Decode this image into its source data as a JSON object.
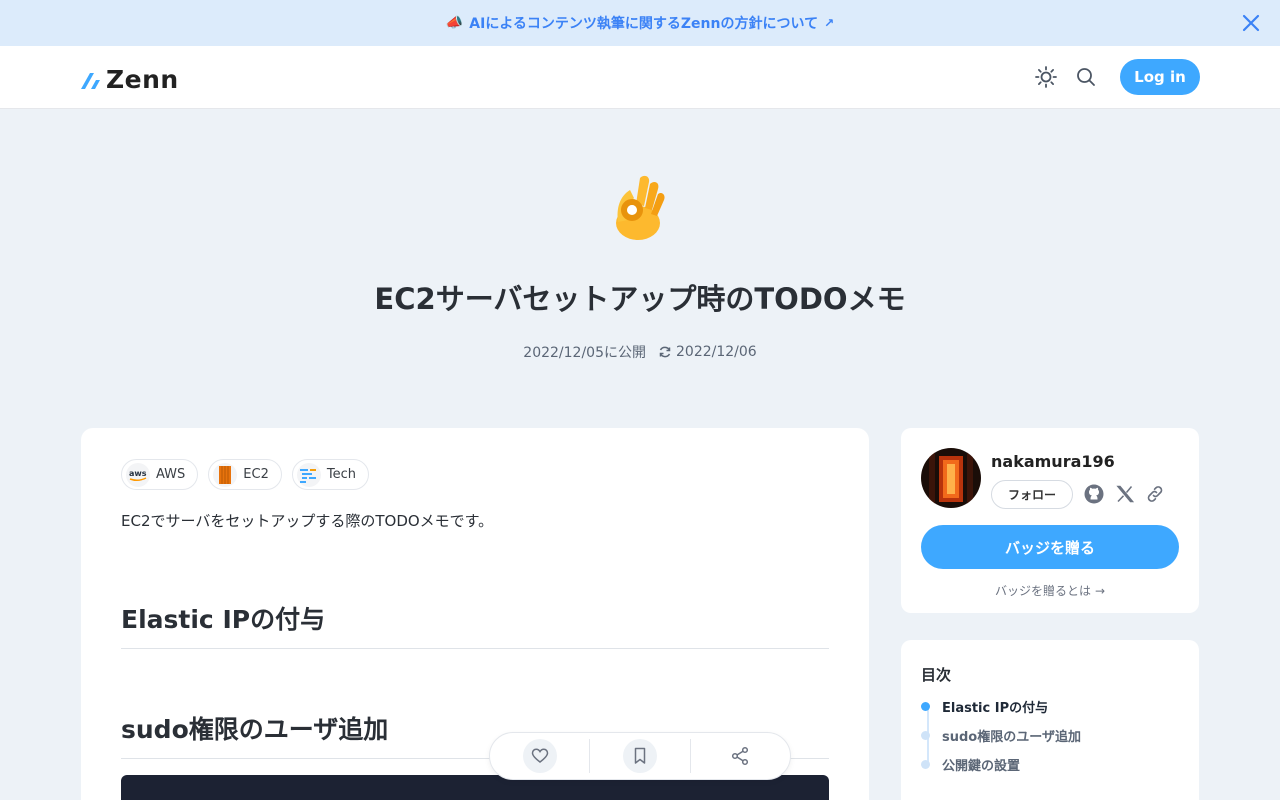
{
  "banner": {
    "emoji": "📣",
    "text": "AIによるコンテンツ執筆に関するZennの方針について",
    "arrow": "↗"
  },
  "header": {
    "logo_text": "Zenn",
    "login_label": "Log in"
  },
  "article": {
    "title": "EC2サーバセットアップ時のTODOメモ",
    "published": "2022/12/05に公開",
    "updated": "2022/12/06",
    "topics": [
      {
        "label": "AWS",
        "icon": "aws-icon"
      },
      {
        "label": "EC2",
        "icon": "ec2-icon"
      },
      {
        "label": "Tech",
        "icon": "tech-icon"
      }
    ],
    "lead": "EC2でサーバをセットアップする際のTODOメモです。",
    "headings": [
      "Elastic IPの付与",
      "sudo権限のユーザ追加"
    ]
  },
  "profile": {
    "username": "nakamura196",
    "follow_label": "フォロー",
    "badge_label": "バッジを贈る",
    "badge_help": "バッジを贈るとは",
    "badge_help_arrow": "→"
  },
  "toc": {
    "title": "目次",
    "items": [
      {
        "label": "Elastic IPの付与",
        "active": true
      },
      {
        "label": "sudo権限のユーザ追加",
        "active": false
      },
      {
        "label": "公開鍵の設置",
        "active": false
      }
    ]
  },
  "colors": {
    "accent": "#3ea8ff",
    "banner_bg": "#dcebfb",
    "page_bg": "#edf2f7"
  }
}
